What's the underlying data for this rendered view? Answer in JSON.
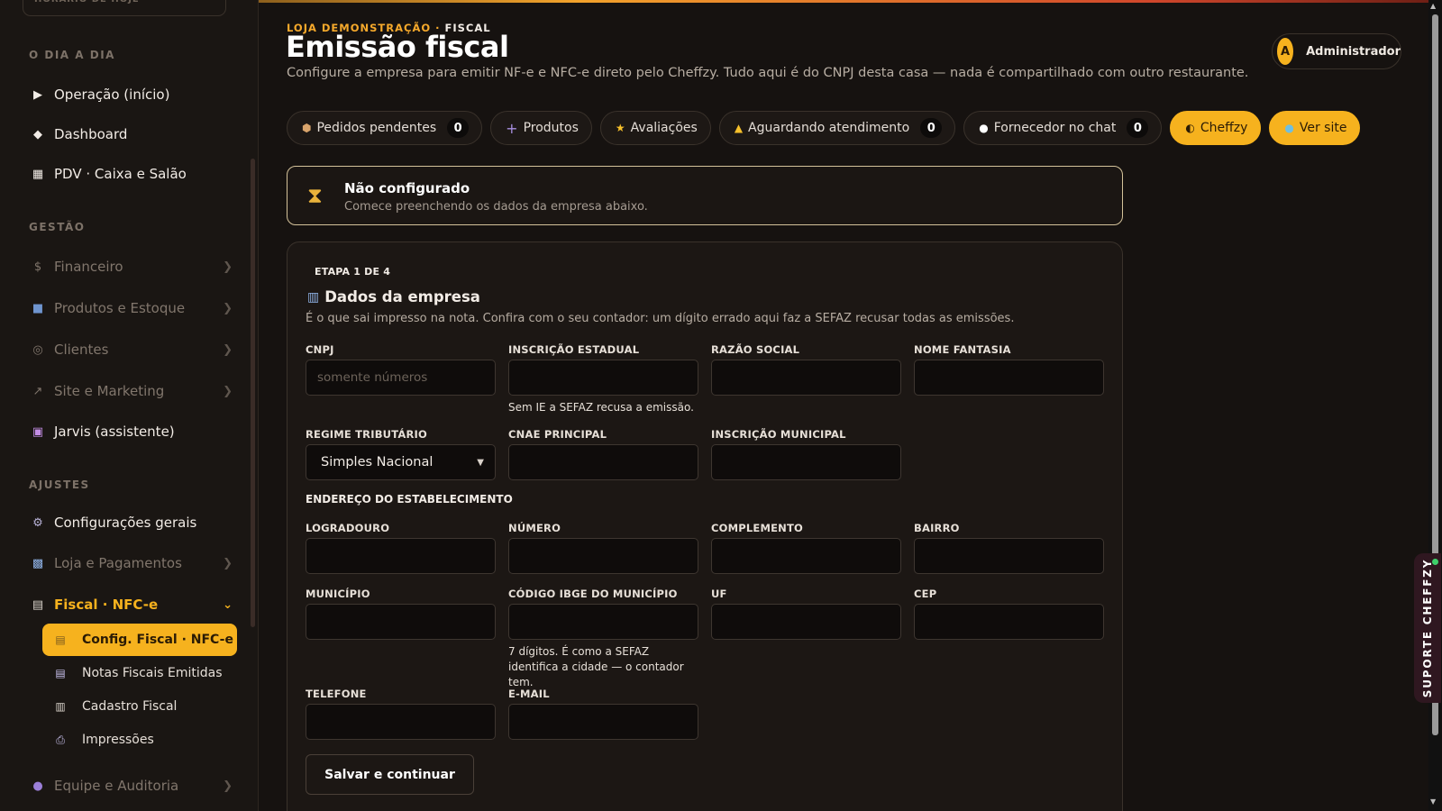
{
  "sidebar": {
    "today_label": "HORÁRIO DE HOJE",
    "sections": [
      "O DIA A DIA",
      "GESTÃO",
      "AJUSTES"
    ],
    "daily": [
      {
        "label": "Operação (início)",
        "icon": "play-icon"
      },
      {
        "label": "Dashboard",
        "icon": "diamond-icon"
      },
      {
        "label": "PDV · Caixa e Salão",
        "icon": "grid-icon"
      }
    ],
    "management": [
      {
        "label": "Financeiro",
        "icon": "dollar-icon"
      },
      {
        "label": "Produtos e Estoque",
        "icon": "box-icon"
      },
      {
        "label": "Clientes",
        "icon": "target-icon"
      },
      {
        "label": "Site e Marketing",
        "icon": "arrow-icon"
      },
      {
        "label": "Jarvis (assistente)",
        "icon": "robot-icon"
      }
    ],
    "settings": [
      {
        "label": "Configurações gerais",
        "icon": "gear-icon"
      },
      {
        "label": "Loja e Pagamentos",
        "icon": "store-icon"
      },
      {
        "label": "Fiscal · NFC-e",
        "icon": "receipt-icon"
      }
    ],
    "fiscal_sub": [
      {
        "label": "Config. Fiscal · NFC-e"
      },
      {
        "label": "Notas Fiscais Emitidas"
      },
      {
        "label": "Cadastro Fiscal"
      },
      {
        "label": "Impressões"
      }
    ],
    "team": {
      "label": "Equipe e Auditoria"
    }
  },
  "header": {
    "store": "LOJA DEMONSTRAÇÃO",
    "separator": " · ",
    "area": "FISCAL",
    "title": "Emissão fiscal",
    "subtitle": "Configure a empresa para emitir NF-e e NFC-e direto pelo Cheffzy. Tudo aqui é do CNPJ desta casa — nada é compartilhado com outro restaurante.",
    "user": {
      "initial": "A",
      "name": "Administrador"
    }
  },
  "chips": {
    "pending": {
      "label": "Pedidos pendentes",
      "count": "0"
    },
    "products": {
      "label": "Produtos"
    },
    "reviews": {
      "label": "Avaliações"
    },
    "waiting": {
      "label": "Aguardando atendimento",
      "count": "0"
    },
    "supplier": {
      "label": "Fornecedor no chat",
      "count": "0"
    },
    "cheffzy": {
      "label": "Cheffzy"
    },
    "site": {
      "label": "Ver site"
    }
  },
  "status": {
    "title": "Não configurado",
    "message": "Comece preenchendo os dados da empresa abaixo."
  },
  "form": {
    "step": "ETAPA 1 DE 4",
    "section_title": "Dados da empresa",
    "section_desc": "É o que sai impresso na nota. Confira com o seu contador: um dígito errado aqui faz a SEFAZ recusar todas as emissões.",
    "labels": {
      "cnpj": "CNPJ",
      "ie": "INSCRIÇÃO ESTADUAL",
      "razao": "RAZÃO SOCIAL",
      "fantasia": "NOME FANTASIA",
      "regime": "REGIME TRIBUTÁRIO",
      "cnae": "CNAE PRINCIPAL",
      "im": "INSCRIÇÃO MUNICIPAL",
      "address_group": "ENDEREÇO DO ESTABELECIMENTO",
      "logradouro": "LOGRADOURO",
      "numero": "NÚMERO",
      "complemento": "COMPLEMENTO",
      "bairro": "BAIRRO",
      "municipio": "MUNICÍPIO",
      "ibge": "CÓDIGO IBGE DO MUNICÍPIO",
      "uf": "UF",
      "cep": "CEP",
      "telefone": "TELEFONE",
      "email": "E-MAIL"
    },
    "values": {
      "cnpj": "",
      "ie": "",
      "razao": "",
      "fantasia": "",
      "cnae": "",
      "im": "",
      "logradouro": "",
      "numero": "",
      "complemento": "",
      "bairro": "",
      "municipio": "",
      "ibge": "",
      "uf": "",
      "cep": "",
      "telefone": "",
      "email": ""
    },
    "placeholders": {
      "cnpj": "somente números"
    },
    "regime_selected": "Simples Nacional",
    "hints": {
      "ie": "Sem IE a SEFAZ recusa a emissão.",
      "ibge": "7 dígitos. É como a SEFAZ identifica a cidade — o contador tem."
    },
    "save_label": "Salvar e continuar"
  },
  "support_label": "SUPORTE CHEFFZY",
  "colors": {
    "accent": "#f6b21e",
    "background": "#161210",
    "active_text": "#2a1b05"
  }
}
